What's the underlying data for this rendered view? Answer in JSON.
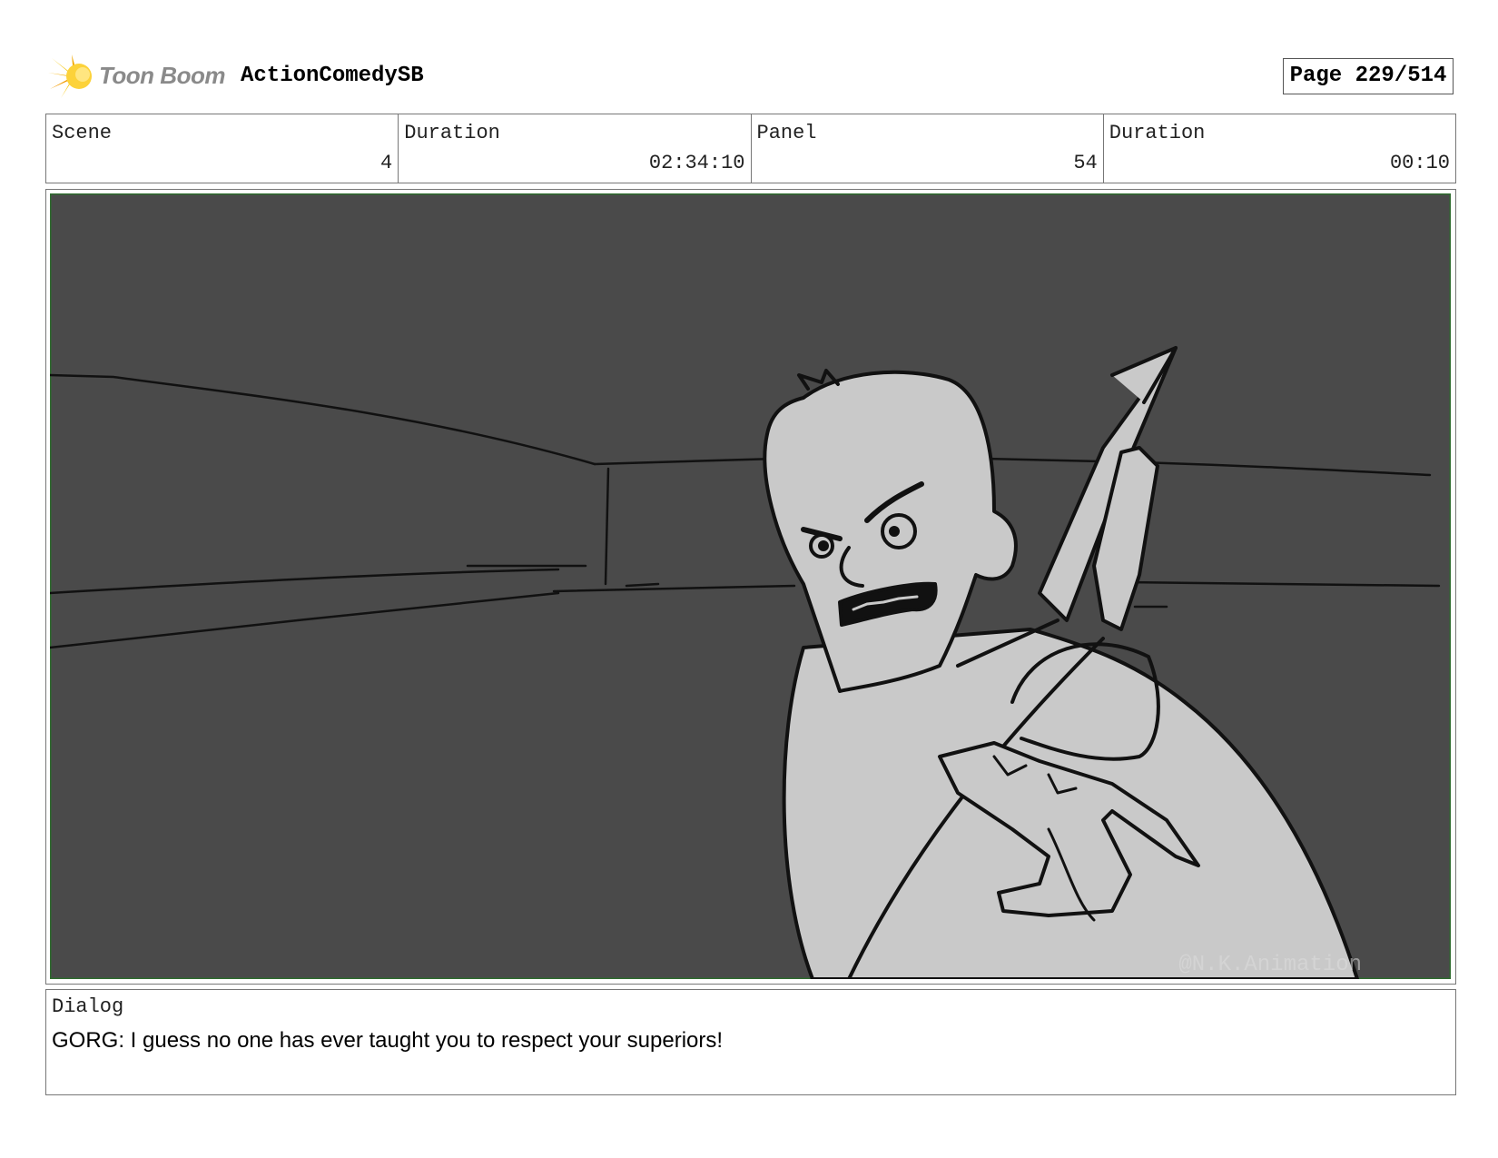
{
  "header": {
    "logo_text": "Toon Boom",
    "project_name": "ActionComedySB",
    "page": "Page 229/514"
  },
  "info": {
    "scene_label": "Scene",
    "scene_value": "4",
    "scene_duration_label": "Duration",
    "scene_duration_value": "02:34:10",
    "panel_label": "Panel",
    "panel_value": "54",
    "panel_duration_label": "Duration",
    "panel_duration_value": "00:10"
  },
  "panel": {
    "watermark": "@N.K.Animation",
    "background_color": "#4a4a4a",
    "frame_color": "#2e6b2e",
    "figure_color": "#c9c9c9"
  },
  "dialog": {
    "label": "Dialog",
    "text": "GORG: I guess no one has ever taught you to respect your superiors!"
  }
}
